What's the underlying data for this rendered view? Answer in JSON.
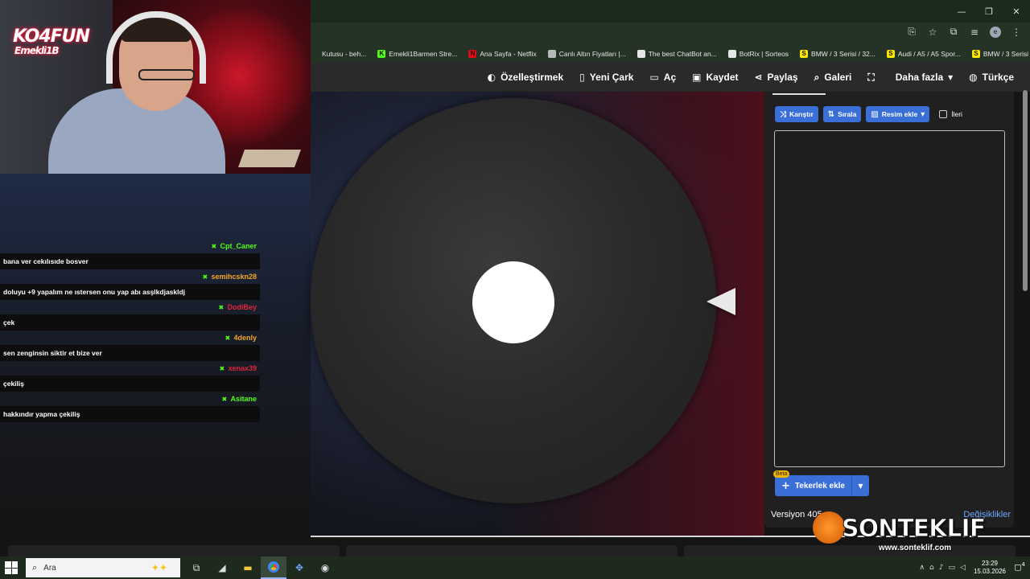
{
  "window_controls": {
    "minimize": "—",
    "restore": "❐",
    "close": "✕"
  },
  "address_icons": {
    "translate": "⎘",
    "star": "☆",
    "extensions": "⧉",
    "media": "≡",
    "avatar": "e",
    "menu": "⋮"
  },
  "bookmarks": [
    {
      "label": "Kutusu - beh...",
      "icon_color": "#243326",
      "icon_text": ""
    },
    {
      "label": "Emekli1Barmen Stre...",
      "icon_color": "#53fc18",
      "icon_text": "K"
    },
    {
      "label": "Ana Sayfa - Netflix",
      "icon_color": "#e50914",
      "icon_text": "N"
    },
    {
      "label": "Canlı Altın Fiyatları |...",
      "icon_color": "#b8b8b8",
      "icon_text": ""
    },
    {
      "label": "The best ChatBot an...",
      "icon_color": "#e6e6e6",
      "icon_text": ""
    },
    {
      "label": "BotRix | Sorteos",
      "icon_color": "#e6e6e6",
      "icon_text": ""
    },
    {
      "label": "BMW / 3 Serisi / 32...",
      "icon_color": "#ffe800",
      "icon_text": "S"
    },
    {
      "label": "Audi / A5 / A5 Spor...",
      "icon_color": "#ffe800",
      "icon_text": "S"
    },
    {
      "label": "BMW / 3 Serisi / 32...",
      "icon_color": "#ffe800",
      "icon_text": "S"
    }
  ],
  "nav": [
    {
      "label": "Özelleştirmek",
      "icon": "palette-icon",
      "glyph": "◐"
    },
    {
      "label": "Yeni Çark",
      "icon": "file-icon",
      "glyph": "▯"
    },
    {
      "label": "Aç",
      "icon": "folder-open-icon",
      "glyph": "▭"
    },
    {
      "label": "Kaydet",
      "icon": "save-icon",
      "glyph": "▣"
    },
    {
      "label": "Paylaş",
      "icon": "share-icon",
      "glyph": "⋖"
    },
    {
      "label": "Galeri",
      "icon": "search-icon",
      "glyph": "⌕"
    },
    {
      "label": "",
      "icon": "fullscreen-icon",
      "glyph": "⛶"
    },
    {
      "label": "Daha fazla",
      "icon": "chevron-down-icon",
      "glyph": "▾"
    },
    {
      "label": "Türkçe",
      "icon": "globe-icon",
      "glyph": "◍"
    }
  ],
  "panel": {
    "shuffle_label": "Karıştır",
    "sort_label": "Sırala",
    "add_image_label": "Resim ekle",
    "advanced_label": "İleri",
    "entries_value": "",
    "beta_label": "Beta",
    "add_wheel_label": "Tekerlek ekle",
    "version_label": "Versiyon 405",
    "changes_label": "Değişiklikler"
  },
  "webcam": {
    "logo_top": "KO4FUN",
    "logo_bottom": "Emekli1B"
  },
  "chat": [
    {
      "user": "Cpt_Caner",
      "user_color": "#53fc18",
      "text": "bana ver cekılısıde bosver"
    },
    {
      "user": "semihcskn28",
      "user_color": "#f4a623",
      "text": "doluyu +9 yapalım ne ıstersen onu yap abı asşlkdjaskldj"
    },
    {
      "user": "DodiBey",
      "user_color": "#e0243a",
      "text": "çek"
    },
    {
      "user": "4denly",
      "user_color": "#f4a623",
      "text": "sen zenginsin siktir et bize ver"
    },
    {
      "user": "xenax39",
      "user_color": "#e0243a",
      "text": "çekiliş"
    },
    {
      "user": "Asitane",
      "user_color": "#53fc18",
      "text": "hakkındır yapma çekiliş"
    }
  ],
  "sponsor": {
    "name": "SONTEKLIF",
    "url": "www.sonteklif.com"
  },
  "taskbar": {
    "search_placeholder": "Ara",
    "time": "23:29",
    "date": "15.03.2026",
    "notifications": "4"
  }
}
